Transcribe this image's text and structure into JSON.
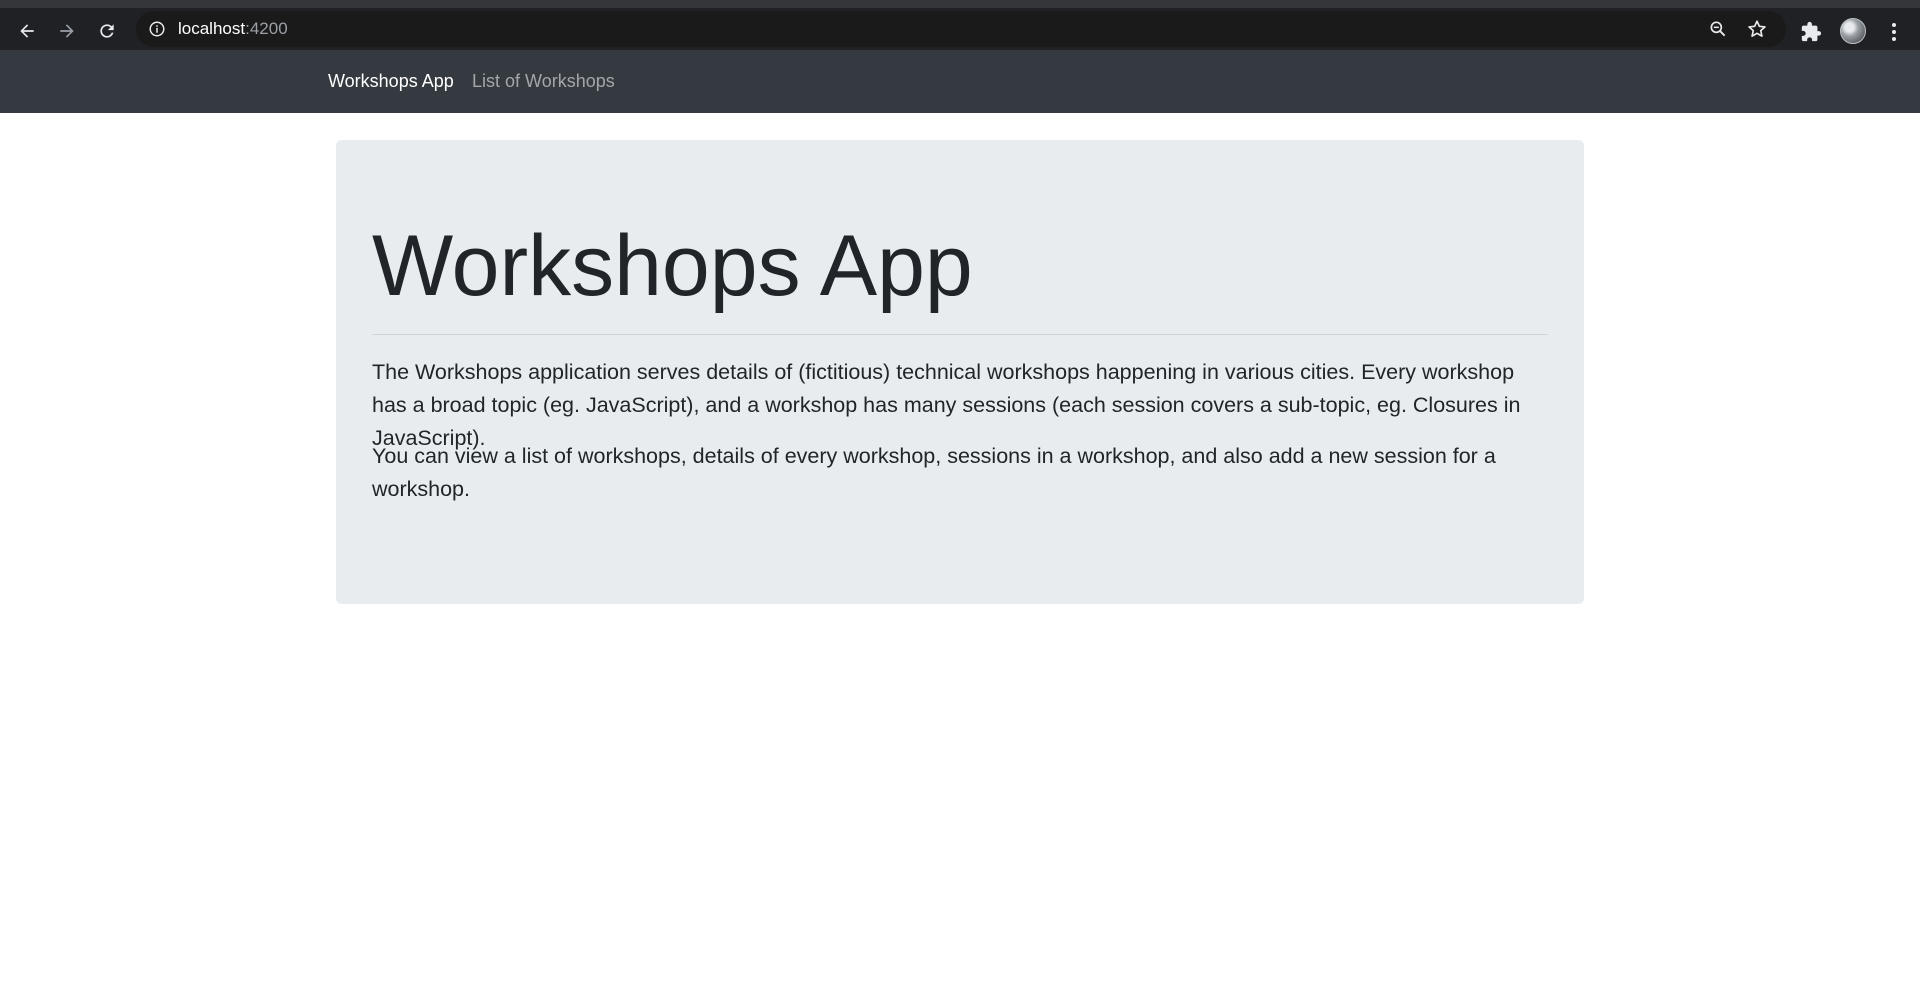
{
  "browser": {
    "url_host": "localhost",
    "url_port": ":4200"
  },
  "navbar": {
    "brand": "Workshops App",
    "links": [
      {
        "label": "List of Workshops"
      }
    ]
  },
  "jumbotron": {
    "title": "Workshops App",
    "paragraphs": [
      "The Workshops application serves details of (fictitious) technical workshops happening in various cities. Every workshop has a broad topic (eg. JavaScript), and a workshop has many sessions (each session covers a sub-topic, eg. Closures in JavaScript).",
      "You can view a list of workshops, details of every workshop, sessions in a workshop, and also add a new session for a workshop."
    ]
  },
  "colors": {
    "chrome_toolbar": "#202124",
    "navbar_bg": "#343a40",
    "jumbotron_bg": "#e9ecef",
    "text": "#212529"
  },
  "icons": {
    "back": "arrow-left-icon",
    "forward": "arrow-right-icon",
    "reload": "reload-icon",
    "site_info": "info-icon",
    "zoom": "zoom-icon",
    "bookmark": "star-icon",
    "extensions": "puzzle-icon",
    "profile": "avatar",
    "menu": "kebab-menu-icon"
  }
}
